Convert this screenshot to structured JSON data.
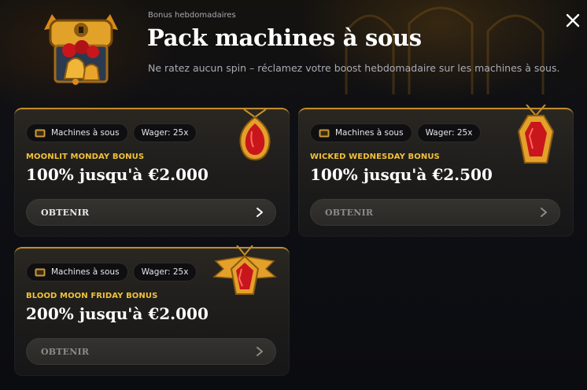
{
  "header": {
    "subtitle": "Bonus hebdomadaires",
    "title": "Pack machines à sous",
    "description": "Ne ratez aucun spin – réclamez votre boost hebdomadaire sur les machines à sous."
  },
  "cards": [
    {
      "tags": [
        "Machines à sous",
        "Wager: 25x"
      ],
      "name": "MOONLIT MONDAY BONUS",
      "amount": "100% jusqu'à €2.000",
      "button": "OBTENIR",
      "enabled": true
    },
    {
      "tags": [
        "Machines à sous",
        "Wager: 25x"
      ],
      "name": "WICKED WEDNESDAY BONUS",
      "amount": "100% jusqu'à €2.500",
      "button": "OBTENIR",
      "enabled": false
    },
    {
      "tags": [
        "Machines à sous",
        "Wager: 25x"
      ],
      "name": "BLOOD MOON FRIDAY BONUS",
      "amount": "200% jusqu'à €2.000",
      "button": "OBTENIR",
      "enabled": false
    }
  ],
  "icons": {
    "close": "close-icon",
    "chest": "treasure-chest-icon",
    "tag": "slot-machine-icon",
    "chevron": "chevron-right-icon"
  },
  "colors": {
    "accent": "#f0c23a",
    "border": "#c48a2a",
    "gem": "#c8161c"
  }
}
